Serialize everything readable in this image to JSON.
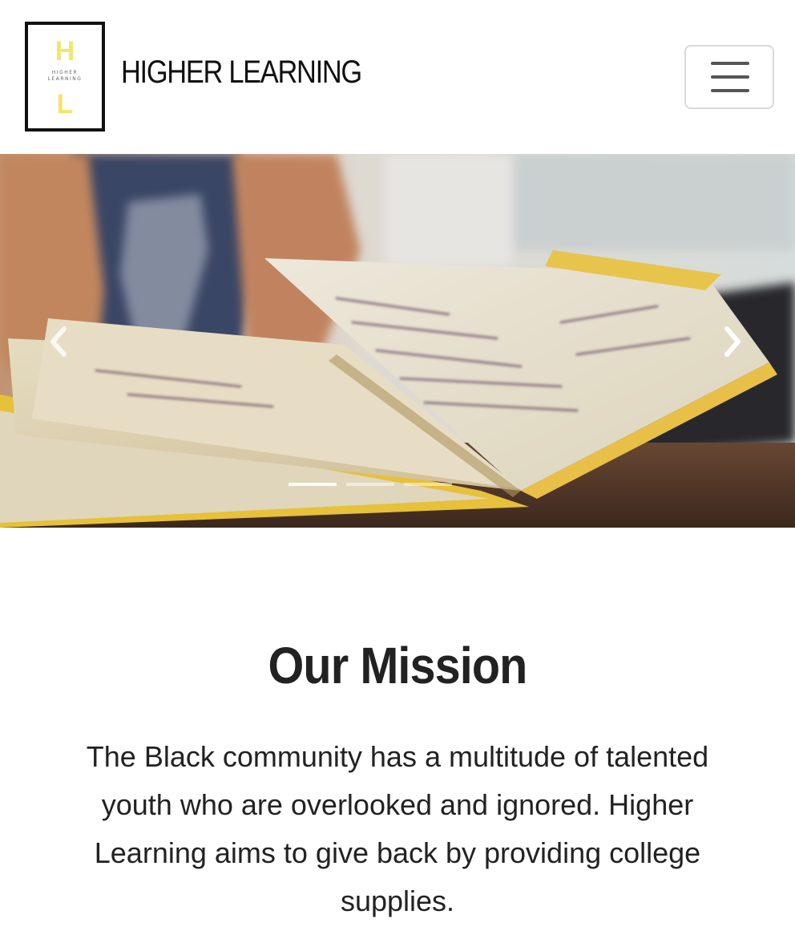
{
  "navbar": {
    "logo": {
      "letter_top": "H",
      "letter_bottom": "L",
      "subtext_line1": "HIGHER",
      "subtext_line2": "LEARNING",
      "accent_color": "#f3e56b"
    },
    "brand_name": "HIGHER LEARNING",
    "menu_icon": "hamburger-icon"
  },
  "carousel": {
    "image_subject": "open notebook with handwritten notes",
    "prev_icon": "chevron-left-icon",
    "next_icon": "chevron-right-icon",
    "slide_count": 3,
    "active_slide": 1
  },
  "mission": {
    "title": "Our Mission",
    "body": "The Black community has a multitude of talented youth who are overlooked and ignored. Higher Learning aims to give back by providing college supplies."
  }
}
